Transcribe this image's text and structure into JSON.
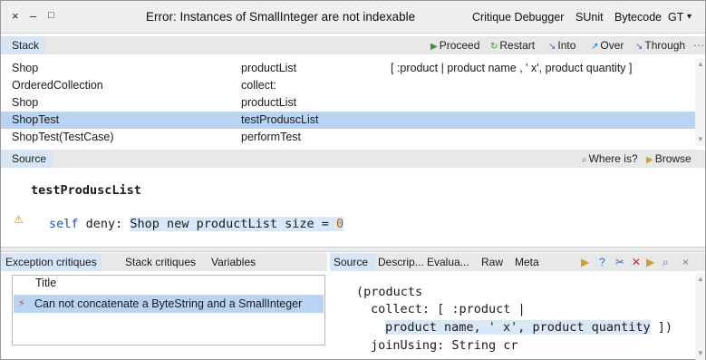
{
  "window": {
    "controls": [
      "×",
      "–",
      "□"
    ],
    "title": "Error: Instances of SmallInteger are not indexable",
    "menu": [
      "Critique Debugger",
      "SUnit",
      "Bytecode",
      "GT",
      "▾"
    ]
  },
  "stack": {
    "tab": "Stack",
    "actions": {
      "proceed": "Proceed",
      "restart": "Restart",
      "into": "Into",
      "over": "Over",
      "through": "Through",
      "more": "⋯"
    },
    "rows": [
      {
        "receiver": "Shop",
        "method": "productList",
        "source": "[ :product | product name , ' x', product quantity ]"
      },
      {
        "receiver": "OrderedCollection",
        "method": "collect:",
        "source": ""
      },
      {
        "receiver": "Shop",
        "method": "productList",
        "source": ""
      },
      {
        "receiver": "ShopTest",
        "method": "testProduscList",
        "source": ""
      },
      {
        "receiver": "ShopTest(TestCase)",
        "method": "performTest",
        "source": ""
      }
    ]
  },
  "source": {
    "tab": "Source",
    "where_is": "Where is?",
    "browse": "Browse",
    "method_name": "testProduscList",
    "line_self": "self",
    "line_deny": " deny: ",
    "line_hl": "Shop new productList size = ",
    "line_num": "0"
  },
  "critiques": {
    "tabs": [
      "Exception critiques",
      "Stack critiques",
      "Variables"
    ],
    "header": "Title",
    "item": "Can not concatenate a ByteString and a SmallInteger"
  },
  "detail": {
    "tabs": [
      "Source",
      "Descrip...",
      "Evalua...",
      "Raw",
      "Meta"
    ],
    "icons": [
      "▶",
      "?",
      "✂",
      "✕",
      "▶",
      "⌕",
      "×"
    ],
    "code": {
      "l1": "(products",
      "l2": "collect: [ :product |",
      "l3": "product name, ' x', product quantity",
      "l3_tail": " ])",
      "l4": "joinUsing: String cr"
    }
  },
  "colors": {
    "selection": "#b8d4f2",
    "tab_active": "#d6e6f6",
    "proceed_green": "#2f9a2f",
    "keyword_blue": "#1a55b0",
    "warning": "#c99a00"
  }
}
